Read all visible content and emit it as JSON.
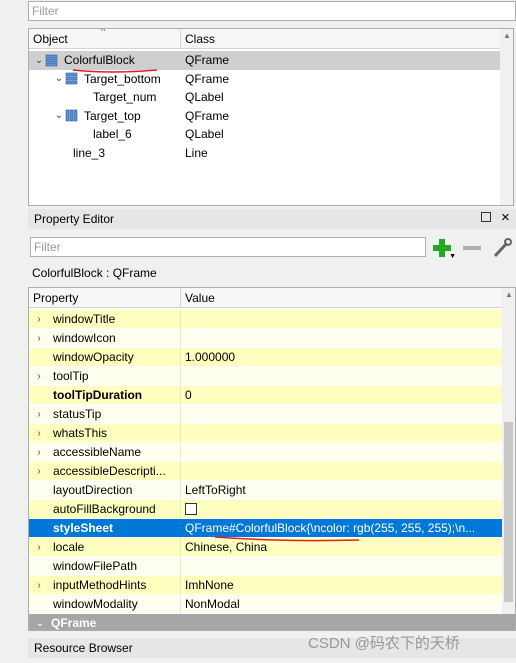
{
  "object_inspector": {
    "filter_placeholder": "Filter",
    "columns": [
      "Object",
      "Class"
    ],
    "rows": [
      {
        "name": "ColorfulBlock",
        "cls": "QFrame",
        "level": 0,
        "expander": "⌄",
        "icon": "vertical-layout-icon"
      },
      {
        "name": "Target_bottom",
        "cls": "QFrame",
        "level": 1,
        "expander": "⌄",
        "icon": "vertical-layout-icon"
      },
      {
        "name": "Target_num",
        "cls": "QLabel",
        "level": 2,
        "expander": "",
        "icon": ""
      },
      {
        "name": "Target_top",
        "cls": "QFrame",
        "level": 1,
        "expander": "⌄",
        "icon": "horizontal-layout-icon"
      },
      {
        "name": "label_6",
        "cls": "QLabel",
        "level": 2,
        "expander": "",
        "icon": ""
      },
      {
        "name": "line_3",
        "cls": "Line",
        "level": 1,
        "expander": "",
        "icon": ""
      }
    ]
  },
  "property_editor": {
    "title": "Property Editor",
    "filter_placeholder": "Filter",
    "object_caption": "ColorfulBlock : QFrame",
    "columns": [
      "Property",
      "Value"
    ],
    "rows": [
      {
        "k": "windowTitle",
        "v": "",
        "exp": true
      },
      {
        "k": "windowIcon",
        "v": "",
        "exp": true
      },
      {
        "k": "windowOpacity",
        "v": "1.000000",
        "exp": false
      },
      {
        "k": "toolTip",
        "v": "",
        "exp": true
      },
      {
        "k": "toolTipDuration",
        "v": "0",
        "exp": false,
        "bold": true
      },
      {
        "k": "statusTip",
        "v": "",
        "exp": true
      },
      {
        "k": "whatsThis",
        "v": "",
        "exp": true
      },
      {
        "k": "accessibleName",
        "v": "",
        "exp": true
      },
      {
        "k": "accessibleDescripti...",
        "v": "",
        "exp": true
      },
      {
        "k": "layoutDirection",
        "v": "LeftToRight",
        "exp": false
      },
      {
        "k": "autoFillBackground",
        "v": "",
        "exp": false,
        "checkbox": true
      },
      {
        "k": "styleSheet",
        "v": "QFrame#ColorfulBlock{\\ncolor: rgb(255, 255, 255);\\n...",
        "exp": false,
        "bold": true,
        "selected": true
      },
      {
        "k": "locale",
        "v": "Chinese, China",
        "exp": true
      },
      {
        "k": "windowFilePath",
        "v": "",
        "exp": false
      },
      {
        "k": "inputMethodHints",
        "v": "ImhNone",
        "exp": true
      },
      {
        "k": "windowModality",
        "v": "NonModal",
        "exp": false
      }
    ],
    "group_label": "QFrame"
  },
  "resource_browser": {
    "title": "Resource Browser"
  },
  "watermark": "CSDN @码农下的天桥",
  "colors": {
    "selection": "#0078d7",
    "annotation": "#e02020",
    "add_icon": "#22a822"
  }
}
